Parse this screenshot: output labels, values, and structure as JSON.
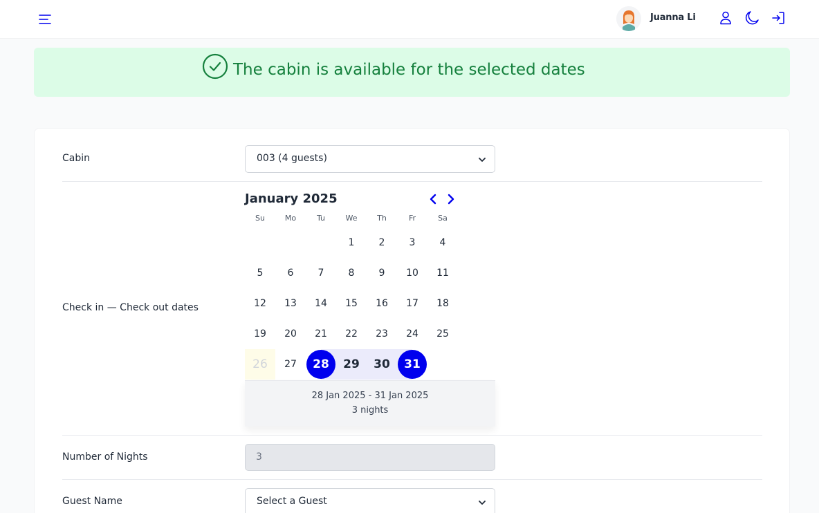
{
  "header": {
    "user_name": "Juanna Li",
    "icons": [
      "menu-icon",
      "avatar",
      "user-icon",
      "moon-icon",
      "logout-icon"
    ]
  },
  "banner": {
    "message": "The cabin is available for the selected dates",
    "color": "#15803d",
    "background": "#dcfce7"
  },
  "form": {
    "cabin_label": "Cabin",
    "cabin_value": "003 (4 guests)",
    "dates_label": "Check in — Check out dates",
    "nights_label": "Number of Nights",
    "nights_value": "3",
    "guest_label": "Guest Name",
    "guest_value": "Select a Guest"
  },
  "calendar": {
    "month_label": "January 2025",
    "weekdays": [
      "Su",
      "Mo",
      "Tu",
      "We",
      "Th",
      "Fr",
      "Sa"
    ],
    "days": [
      "1",
      "2",
      "3",
      "4",
      "5",
      "6",
      "7",
      "8",
      "9",
      "10",
      "11",
      "12",
      "13",
      "14",
      "15",
      "16",
      "17",
      "18",
      "19",
      "20",
      "21",
      "22",
      "23",
      "24",
      "25",
      "26",
      "27",
      "28",
      "29",
      "30",
      "31"
    ],
    "range_text": "28 Jan 2025 - 31 Jan 2025",
    "nights_text": "3 nights",
    "accent": "#0000ee"
  }
}
